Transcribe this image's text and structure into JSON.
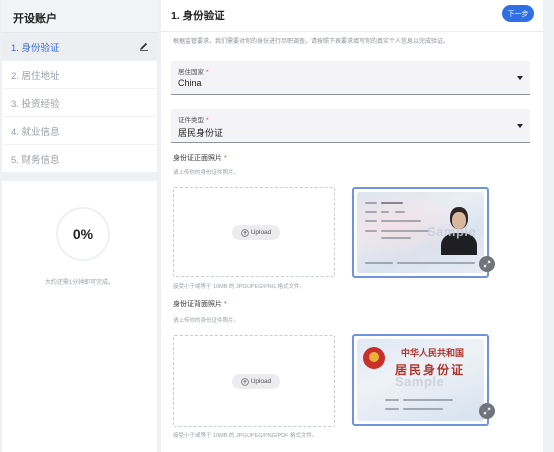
{
  "sidebar": {
    "title": "开设账户",
    "steps": [
      {
        "label": "1. 身份验证",
        "active": true
      },
      {
        "label": "2. 居住地址",
        "active": false
      },
      {
        "label": "3. 投资经验",
        "active": false
      },
      {
        "label": "4. 就业信息",
        "active": false
      },
      {
        "label": "5. 财务信息",
        "active": false
      }
    ],
    "progress_percent": "0%",
    "progress_note": "大约还需1分钟即可完成。"
  },
  "main": {
    "title": "1. 身份验证",
    "next_button": "下一步",
    "intro": "根据监管要求，我们需要对你的身份进行尽职调查。请按照下表要求填写你的真实个人信息以完成验证。",
    "country_field": {
      "label": "居住国家",
      "required_mark": "*",
      "value": "China"
    },
    "id_type_field": {
      "label": "证件类型",
      "required_mark": "*",
      "value": "居民身份证"
    },
    "front_upload": {
      "title": "身份证正面照片",
      "required_mark": "*",
      "subtitle": "请上传你的身份证件照片。",
      "button": "Upload",
      "hint": "接受小于或等于 10MB 的 JPG/JPEG/PNG 格式文件。",
      "sample_watermark": "Sample"
    },
    "back_upload": {
      "title": "身份证背面照片",
      "required_mark": "*",
      "subtitle": "请上传你的身份证件照片。",
      "button": "Upload",
      "hint": "接受小于或等于 10MB 的 JPG/JPEG/PNG/PDF 格式文件。",
      "sample_watermark": "Sample",
      "card_title": "中华人民共和国",
      "card_subtitle": "居民身份证"
    }
  },
  "colors": {
    "accent": "#2f6fe6",
    "active_text": "#3b6cd9",
    "required": "#e0443b"
  }
}
